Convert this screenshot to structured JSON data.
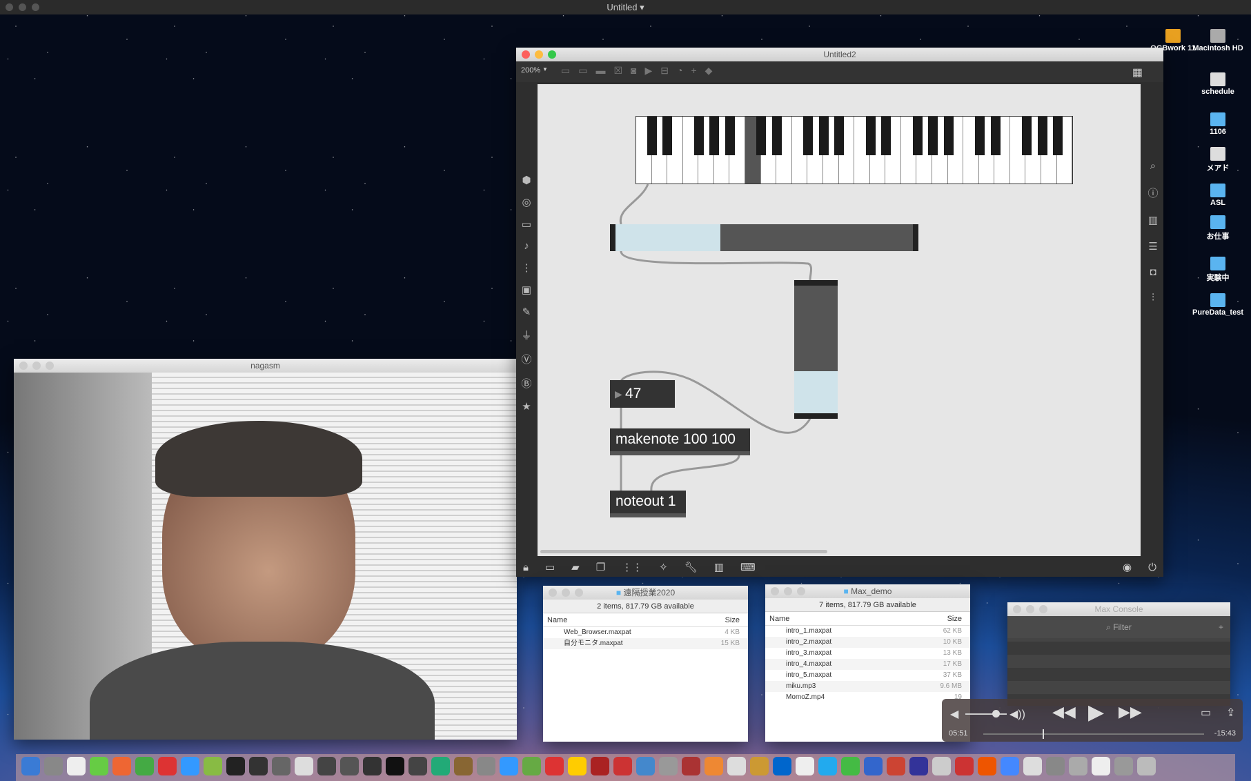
{
  "menubar": {
    "title": "Untitled"
  },
  "max": {
    "title": "Untitled2",
    "zoom": "200%",
    "number": "47",
    "makenote": "makenote 100 100",
    "noteout": "noteout 1",
    "hslider_value": 0.36,
    "vslider_value": 0.34,
    "pressed_key": "C"
  },
  "video": {
    "title": "nagasm"
  },
  "finder1": {
    "title": "遠隔授業2020",
    "info": "2 items, 817.79 GB available",
    "col_name": "Name",
    "col_size": "Size",
    "files": [
      {
        "name": "Web_Browser.maxpat",
        "size": "4 KB"
      },
      {
        "name": "自分モニタ.maxpat",
        "size": "15 KB"
      }
    ]
  },
  "finder2": {
    "title": "Max_demo",
    "info": "7 items, 817.79 GB available",
    "col_name": "Name",
    "col_size": "Size",
    "files": [
      {
        "name": "intro_1.maxpat",
        "size": "62 KB"
      },
      {
        "name": "intro_2.maxpat",
        "size": "10 KB"
      },
      {
        "name": "intro_3.maxpat",
        "size": "13 KB"
      },
      {
        "name": "intro_4.maxpat",
        "size": "17 KB"
      },
      {
        "name": "intro_5.maxpat",
        "size": "37 KB"
      },
      {
        "name": "miku.mp3",
        "size": "9.6 MB"
      },
      {
        "name": "MomoZ.mp4",
        "size": "19"
      }
    ]
  },
  "console": {
    "title": "Max Console",
    "filter": "Filter"
  },
  "player": {
    "elapsed": "05:51",
    "remaining": "-15:43",
    "progress": 0.27,
    "volume": 0.7
  },
  "desktop": [
    "OGBwork 11",
    "Macintosh HD",
    "schedule",
    "1106",
    "メアド",
    "ASL",
    "お仕事",
    "実験中",
    "PureData_test"
  ]
}
